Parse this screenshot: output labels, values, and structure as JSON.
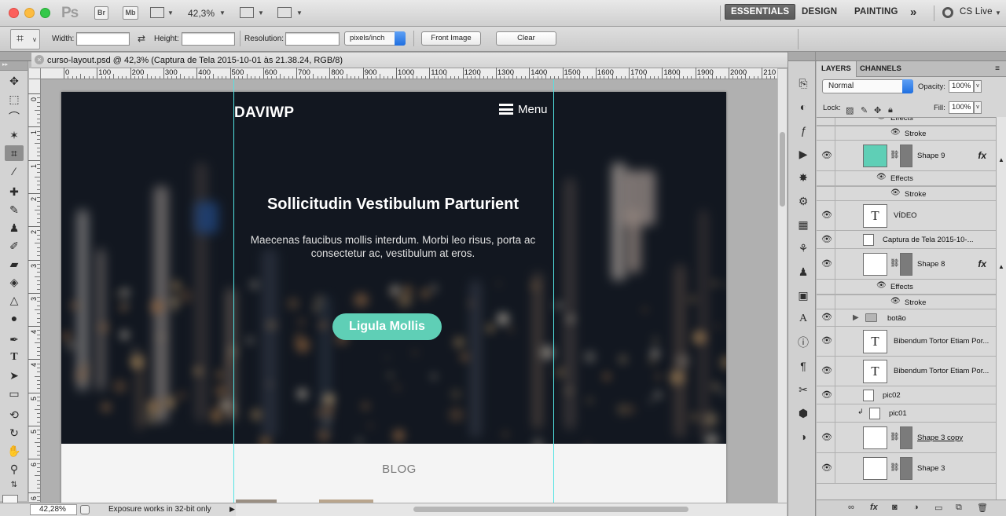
{
  "app": {
    "logo": "Ps",
    "bridge": "Br",
    "minibridge": "Mb",
    "zoom": "42,3%",
    "workspaces": [
      "ESSENTIALS",
      "DESIGN",
      "PAINTING"
    ],
    "more": "»",
    "cs_live": "CS Live"
  },
  "options": {
    "width_label": "Width:",
    "height_label": "Height:",
    "resolution_label": "Resolution:",
    "units": "pixels/inch",
    "front_image": "Front Image",
    "clear": "Clear"
  },
  "document": {
    "tab_title": "curso-layout.psd @ 42,3% (Captura de Tela 2015-10-01 às 21.38.24, RGB/8)",
    "close": "×"
  },
  "ruler": {
    "h_labels": [
      "0",
      "100",
      "200",
      "300",
      "400",
      "500",
      "600",
      "700",
      "800",
      "900",
      "1000",
      "1100",
      "1200",
      "1300",
      "1400",
      "1500",
      "1600",
      "1700",
      "1800",
      "1900",
      "2000",
      "210"
    ],
    "v_labels": [
      "0",
      "1",
      "1",
      "2",
      "2",
      "3",
      "3",
      "4",
      "4",
      "5",
      "5",
      "6",
      "6",
      "7"
    ]
  },
  "site": {
    "brand": "DAVIWP",
    "menu": "Menu",
    "hero_title": "Sollicitudin Vestibulum Parturient",
    "hero_text": "Maecenas faucibus mollis interdum. Morbi leo risus, porta ac consectetur ac, vestibulum at eros.",
    "cta": "Ligula Mollis",
    "section": "BLOG",
    "accent": "#5fcfb6"
  },
  "status": {
    "zoom": "42,28%",
    "message": "Exposure works in 32-bit only"
  },
  "layers_panel": {
    "tabs": [
      "LAYERS",
      "CHANNELS"
    ],
    "blend_mode": "Normal",
    "opacity_label": "Opacity:",
    "opacity": "100%",
    "lock_label": "Lock:",
    "fill_label": "Fill:",
    "fill": "100%",
    "layers": [
      {
        "name": "Effects",
        "kind": "effects"
      },
      {
        "name": "Stroke",
        "kind": "effect"
      },
      {
        "name": "Shape 9",
        "kind": "shape",
        "fx": "fx",
        "color": "#5fcfb6"
      },
      {
        "name": "Effects",
        "kind": "effects"
      },
      {
        "name": "Stroke",
        "kind": "effect"
      },
      {
        "name": "VÍDEO",
        "kind": "text"
      },
      {
        "name": "Captura de Tela 2015-10-...",
        "kind": "smart"
      },
      {
        "name": "Shape 8",
        "kind": "shape",
        "fx": "fx",
        "color": "#ffffff"
      },
      {
        "name": "Effects",
        "kind": "effects"
      },
      {
        "name": "Stroke",
        "kind": "effect"
      },
      {
        "name": "botão",
        "kind": "group"
      },
      {
        "name": "Bibendum Tortor Etiam Por...",
        "kind": "text"
      },
      {
        "name": "Bibendum Tortor Etiam Por...",
        "kind": "text"
      },
      {
        "name": "pic02",
        "kind": "smart"
      },
      {
        "name": "pic01",
        "kind": "smart"
      },
      {
        "name": "Shape 3 copy",
        "kind": "shape",
        "color": "#ffffff"
      },
      {
        "name": "Shape 3",
        "kind": "shape",
        "color": "#ffffff"
      }
    ]
  }
}
